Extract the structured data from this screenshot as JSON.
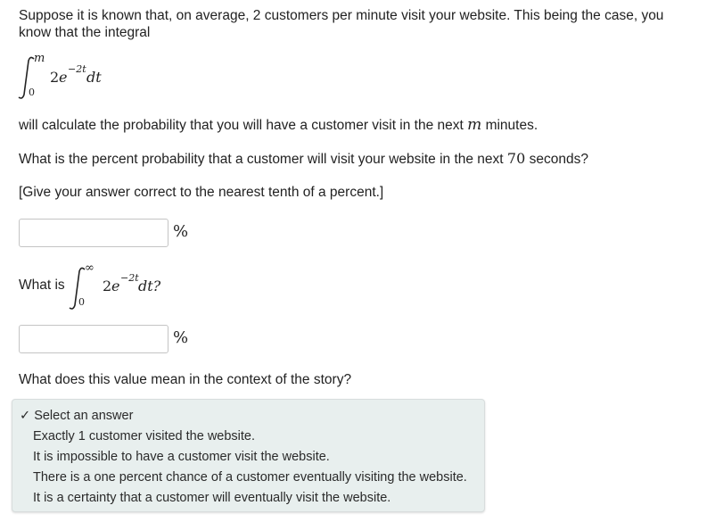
{
  "question": {
    "intro_line1": "Suppose it is known that, on average, 2 customers per minute visit your website. This being the case, you",
    "intro_line2": "know that the integral",
    "integral1": {
      "upper": "m",
      "lower": "0",
      "coef": "2",
      "base": "e",
      "exponent": "−2t",
      "diff": "dt"
    },
    "will_calc_prefix": "will calculate the probability that you will have a customer visit in the next",
    "will_calc_var": "m",
    "will_calc_suffix": "minutes.",
    "ask_prefix": "What is the percent probability that a customer will visit your website in the next",
    "ask_value": "70",
    "ask_suffix": "seconds?",
    "instruction": "[Give your answer correct to the nearest tenth of a percent.]"
  },
  "answer1": {
    "value": "",
    "unit": "%"
  },
  "part2": {
    "prefix": "What is",
    "integral": {
      "upper": "∞",
      "lower": "0",
      "coef": "2",
      "base": "e",
      "exponent": "−2t",
      "diff": "dt?"
    }
  },
  "answer2": {
    "value": "",
    "unit": "%"
  },
  "part3": {
    "question": "What does this value mean in the context of the story?",
    "dropdown": {
      "selected": "Select an answer",
      "options": [
        "Exactly 1 customer visited the website.",
        "It is impossible to have a customer visit the website.",
        "There is a one percent chance of a customer eventually visiting the website.",
        "It is a certainty that a customer will eventually visit the website."
      ]
    }
  }
}
